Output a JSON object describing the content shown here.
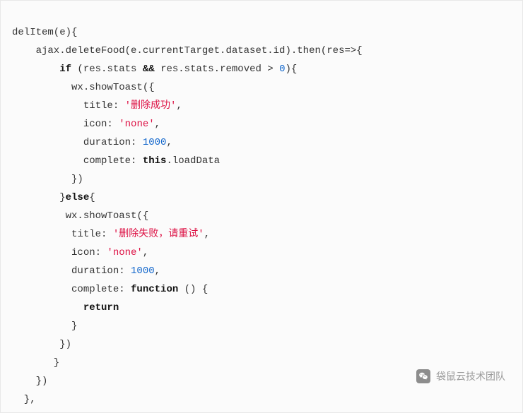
{
  "code": {
    "l1": "delItem(e){",
    "l2_a": "    ajax.deleteFood(e.currentTarget.dataset.id).then(res=>{",
    "l3_a": "        ",
    "l3_kw_if": "if",
    "l3_b": " (res.stats ",
    "l3_kw_and": "&&",
    "l3_c": " res.stats.removed > ",
    "l3_num0": "0",
    "l3_d": "){",
    "l4": "          wx.showToast({",
    "l5_a": "            title: ",
    "l5_str": "'删除成功'",
    "l5_b": ",",
    "l6_a": "            icon: ",
    "l6_str": "'none'",
    "l6_b": ",",
    "l7_a": "            duration: ",
    "l7_num": "1000",
    "l7_b": ",",
    "l8_a": "            complete: ",
    "l8_kw_this": "this",
    "l8_b": ".loadData",
    "l9": "          })",
    "l10_a": "        }",
    "l10_kw_else": "else",
    "l10_b": "{",
    "l11": "         wx.showToast({",
    "l12_a": "          title: ",
    "l12_str": "'删除失败，请重试'",
    "l12_b": ",",
    "l13_a": "          icon: ",
    "l13_str": "'none'",
    "l13_b": ",",
    "l14_a": "          duration: ",
    "l14_num": "1000",
    "l14_b": ",",
    "l15_a": "          complete: ",
    "l15_kw_fn": "function",
    "l15_b": " () {",
    "l16_a": "            ",
    "l16_kw_ret": "return",
    "l17": "          }",
    "l18": "        })",
    "l19": "       }",
    "l20": "    })",
    "l21": "  },"
  },
  "watermark": {
    "label": "袋鼠云技术团队",
    "icon_name": "wechat-icon"
  }
}
